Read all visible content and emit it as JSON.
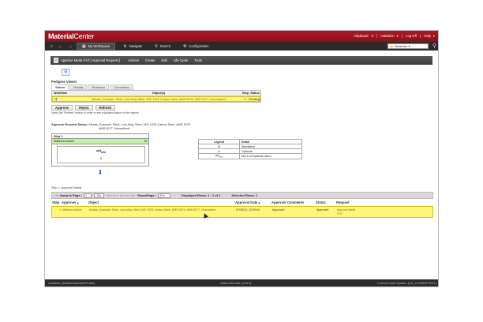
{
  "app": {
    "brand_bold": "Material",
    "brand_thin": "Center",
    "userbar": {
      "clipboard": "Clipboard",
      "clipboard_count": "0",
      "user": "mattdmin",
      "logoff": "Log Off",
      "help": "Help"
    }
  },
  "nav": {
    "home_icon": "home-icon",
    "back_icon": "back-arrow-icon",
    "forward_icon": "forward-arrow-icon",
    "tabs": [
      {
        "label": "My Workspace",
        "active": true
      },
      {
        "label": "Navigate",
        "active": false
      },
      {
        "label": "Search",
        "active": false
      },
      {
        "label": "Configuration",
        "active": false
      }
    ],
    "materials_select": "Materials"
  },
  "toolbar": {
    "title": "Approve Metal XYZ [ Approval Request ]",
    "items": [
      "Actions",
      "Create",
      "Edit",
      "Life Cycle",
      "Tools"
    ]
  },
  "pedigree": {
    "label": "Pedigree Viewer",
    "tabs": [
      "Status",
      "Details",
      "Relations",
      "Comments"
    ]
  },
  "workflow_table": {
    "headers": [
      "Workflow",
      "Object(s)",
      "Step",
      "Status"
    ],
    "row": {
      "object": "Metals_Example: Steel, Low-Alloy Steel, AISI 1025 Carbon Steel, AMS 5075, AMS 5077, Normalized",
      "step": "1",
      "status": "Pending"
    }
  },
  "buttons": {
    "approve": "Approve",
    "reject": "Reject",
    "refresh": "Refresh"
  },
  "note": "Note:Use 'Refresh' button in order to see udpdated status of the objects.",
  "approval_status": {
    "label": "Approval Request Status:",
    "line1": "Metals_Example: Steel, Low-Alloy Steel, AISI 1025 Carbon Steel, AMS 5075,",
    "line2": "AMS 5077, Normalized"
  },
  "step_box": {
    "title": "Step 1",
    "approver": "Matthew Admin",
    "flag": "M",
    "opt_label": "opt",
    "opt_sub": "min",
    "count": "0"
  },
  "legend": {
    "head": [
      "Legend",
      "Detail"
    ],
    "rows": [
      {
        "key": "M",
        "detail": "Mandatory"
      },
      {
        "key": "O",
        "detail": "Optional"
      },
      {
        "key": "opt",
        "sub": "min",
        "detail": "Min # of Optional Users"
      }
    ]
  },
  "step_approval_label": "Step 1: Approval Details",
  "grid_toolbar": {
    "jump_label": "Jump to Page :",
    "page": "1",
    "go": "Go",
    "pager_prev": "|<< << <",
    "pager_cur": "1",
    "pager_next": "> >> >>|",
    "rows_label": "Rows/Page :",
    "rows_value": "25",
    "displayed": "Displayed Rows: 1 - 1 of 1",
    "selected": "Selected Rows: 1"
  },
  "grid": {
    "headers": [
      "Step",
      "Approver",
      "Object",
      "Approval Date",
      "Approver Comments",
      "Status",
      "Request"
    ],
    "row": {
      "step": "1",
      "approver": "Matthew Admin",
      "object": "Metals_Example: Steel, Low-Alloy Steel, AISI 1025 Carbon Steel, AMS 5075, AMS 5077, Normalized",
      "date": "07/30/13, 12:00:44",
      "comments": "Approved",
      "status": "Approved",
      "request": "Approve Metal XYZ"
    }
  },
  "statusbar": {
    "left": "mattdmin (MattAdminUserProfile)",
    "center": "MaterialCenter (2013)",
    "right": "Current Units System (US_CONSISTENT)"
  },
  "colors": {
    "titlebar": "#b01622",
    "highlight": "#fdf67a",
    "approver_row": "#c5f0a8"
  }
}
